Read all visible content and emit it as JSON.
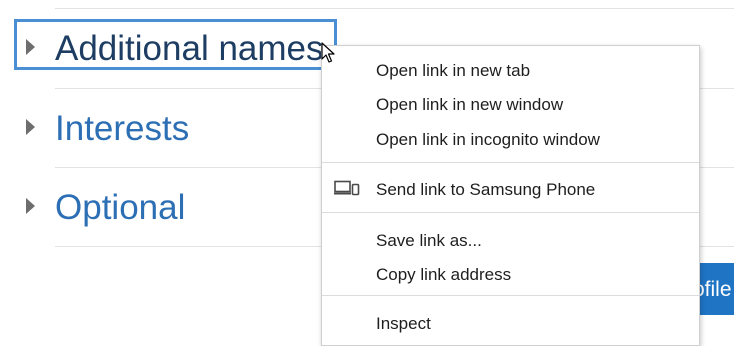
{
  "sections": [
    {
      "label": "Additional names",
      "color": "#1d3d62"
    },
    {
      "label": "Interests",
      "color": "#2d6fb4"
    },
    {
      "label": "Optional",
      "color": "#2d6fb4"
    }
  ],
  "profile_button": {
    "label": "ofile"
  },
  "context_menu": {
    "items": [
      "Open link in new tab",
      "Open link in new window",
      "Open link in incognito window",
      "Send link to Samsung Phone",
      "Save link as...",
      "Copy link address",
      "Inspect"
    ],
    "device_icon": "devices-icon"
  },
  "colors": {
    "accent": "#1f74c4",
    "focus": "#4a8fd4"
  }
}
